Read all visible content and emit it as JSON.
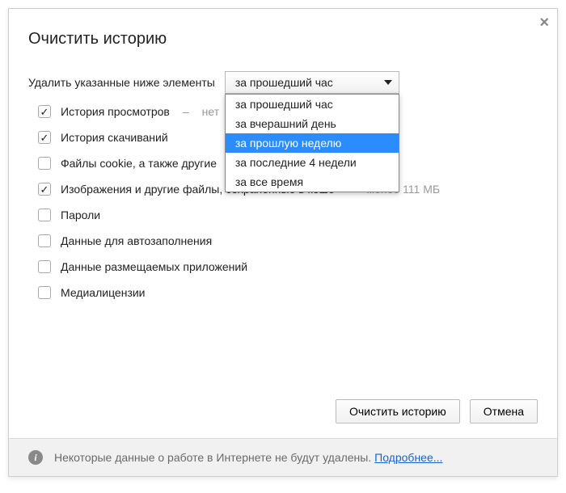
{
  "title": "Очистить историю",
  "period_label": "Удалить указанные ниже элементы",
  "selected_period": "за прошедший час",
  "dropdown": {
    "options": [
      {
        "label": "за прошедший час",
        "highlighted": false
      },
      {
        "label": "за вчерашний день",
        "highlighted": false
      },
      {
        "label": "за прошлую неделю",
        "highlighted": true
      },
      {
        "label": "за последние 4 недели",
        "highlighted": false
      },
      {
        "label": "за все время",
        "highlighted": false
      }
    ]
  },
  "items": [
    {
      "label": "История просмотров",
      "checked": true,
      "hint": "нет"
    },
    {
      "label": "История скачиваний",
      "checked": true,
      "hint": ""
    },
    {
      "label": "Файлы cookie, а также другие ",
      "checked": false,
      "hint": ""
    },
    {
      "label": "Изображения и другие файлы, сохраненные в кеше",
      "checked": true,
      "hint": "менее 111 МБ"
    },
    {
      "label": "Пароли",
      "checked": false,
      "hint": ""
    },
    {
      "label": "Данные для автозаполнения",
      "checked": false,
      "hint": ""
    },
    {
      "label": "Данные размещаемых приложений",
      "checked": false,
      "hint": ""
    },
    {
      "label": "Медиалицензии",
      "checked": false,
      "hint": ""
    }
  ],
  "buttons": {
    "clear": "Очистить историю",
    "cancel": "Отмена"
  },
  "notice": {
    "text": "Некоторые данные о работе в Интернете не будут удалены.",
    "link": "Подробнее..."
  }
}
